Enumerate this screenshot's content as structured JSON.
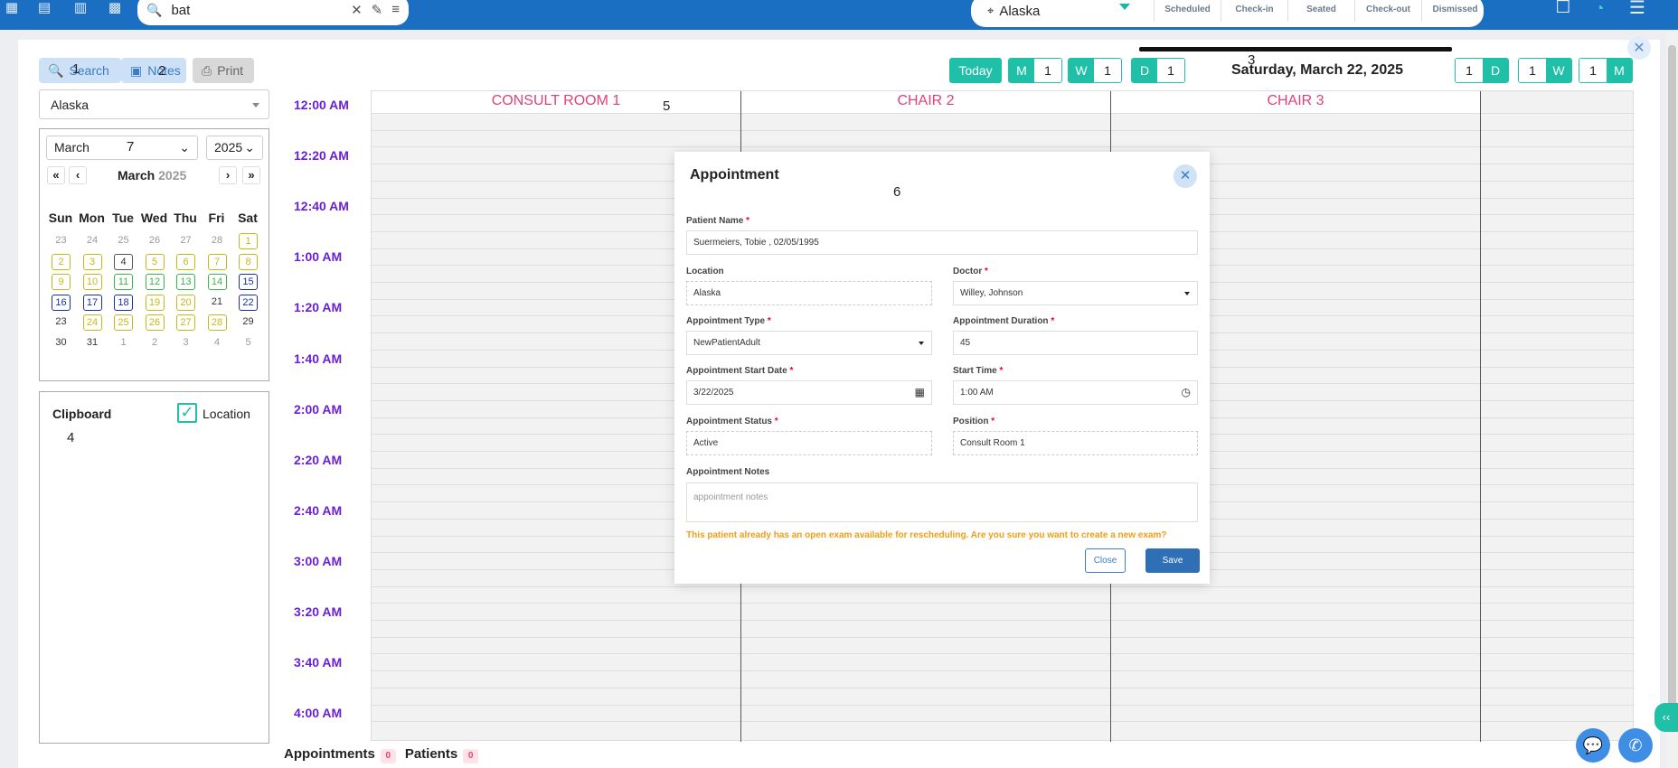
{
  "topbar": {
    "icons": [
      "calendar-icon",
      "report-icon",
      "chart-icon",
      "building-icon"
    ],
    "search": {
      "value": "bat",
      "clear": "✕",
      "pin": "📌",
      "filter": "⚙"
    },
    "location": "Alaska",
    "statuses": [
      "Scheduled",
      "Check-in",
      "Seated",
      "Check-out",
      "Dismissed"
    ],
    "right_icons": [
      "chat-icon",
      "signal-icon",
      "menu-icon"
    ]
  },
  "toolbar": {
    "search_label": "Search",
    "notes_label": "Notes",
    "print_label": "Print",
    "today_label": "Today",
    "m_label": "M",
    "m_val": "1",
    "w_label": "W",
    "w_val": "1",
    "d_label": "D",
    "d_val": "1",
    "date_title": "Saturday, March 22, 2025",
    "r_d_val": "1",
    "r_d_label": "D",
    "r_w_val": "1",
    "r_w_label": "W",
    "r_m_val": "1",
    "r_m_label": "M"
  },
  "badges": {
    "n1": "1",
    "n2": "2",
    "n3": "3",
    "n4": "4",
    "n5": "5",
    "n6": "6",
    "n7": "7"
  },
  "left": {
    "location_select": "Alaska",
    "month_select": "March",
    "year_select": "2025",
    "cal_month": "March",
    "cal_year": "2025",
    "nav": [
      "«",
      "‹",
      "›",
      "»"
    ],
    "dow": [
      "Sun",
      "Mon",
      "Tue",
      "Wed",
      "Thu",
      "Fri",
      "Sat"
    ],
    "days": [
      [
        "23",
        "24",
        "25",
        "26",
        "27",
        "28",
        "1"
      ],
      [
        "2",
        "3",
        "4",
        "5",
        "6",
        "7",
        "8"
      ],
      [
        "9",
        "10",
        "11",
        "12",
        "13",
        "14",
        "15"
      ],
      [
        "16",
        "17",
        "18",
        "19",
        "20",
        "21",
        "22"
      ],
      [
        "23",
        "24",
        "25",
        "26",
        "27",
        "28",
        "29"
      ],
      [
        "30",
        "31",
        "1",
        "2",
        "3",
        "4",
        "5"
      ]
    ],
    "clipboard_title": "Clipboard",
    "clipboard_location": "Location"
  },
  "schedule": {
    "columns": [
      "CONSULT ROOM 1",
      "CHAIR 2",
      "CHAIR 3"
    ],
    "times": [
      "12:00 AM",
      "12:20 AM",
      "12:40 AM",
      "1:00 AM",
      "1:20 AM",
      "1:40 AM",
      "2:00 AM",
      "2:20 AM",
      "2:40 AM",
      "3:00 AM",
      "3:20 AM",
      "3:40 AM",
      "4:00 AM"
    ]
  },
  "modal": {
    "title": "Appointment",
    "patient_name_label": "Patient Name",
    "patient_name": "Suermeiers, Tobie , 02/05/1995",
    "location_label": "Location",
    "location": "Alaska",
    "doctor_label": "Doctor",
    "doctor": "Willey, Johnson",
    "appt_type_label": "Appointment Type",
    "appt_type": "NewPatientAdult",
    "duration_label": "Appointment Duration",
    "duration": "45",
    "start_date_label": "Appointment Start Date",
    "start_date": "3/22/2025",
    "start_time_label": "Start Time",
    "start_time": "1:00 AM",
    "status_label": "Appointment Status",
    "status": "Active",
    "position_label": "Position",
    "position": "Consult Room 1",
    "notes_label": "Appointment Notes",
    "notes_placeholder": "appointment notes",
    "warning": "This patient already has an open exam available for rescheduling. Are you sure you want to create a new exam?",
    "close_label": "Close",
    "save_label": "Save"
  },
  "bottom": {
    "appointments_label": "Appointments",
    "appointments_count": "0",
    "patients_label": "Patients",
    "patients_count": "0"
  },
  "colors": {
    "primary": "#1b6fc2",
    "teal": "#1fbfa8",
    "pink": "#e0427a",
    "purple": "#6a1fd6",
    "warning": "#f39c12"
  }
}
